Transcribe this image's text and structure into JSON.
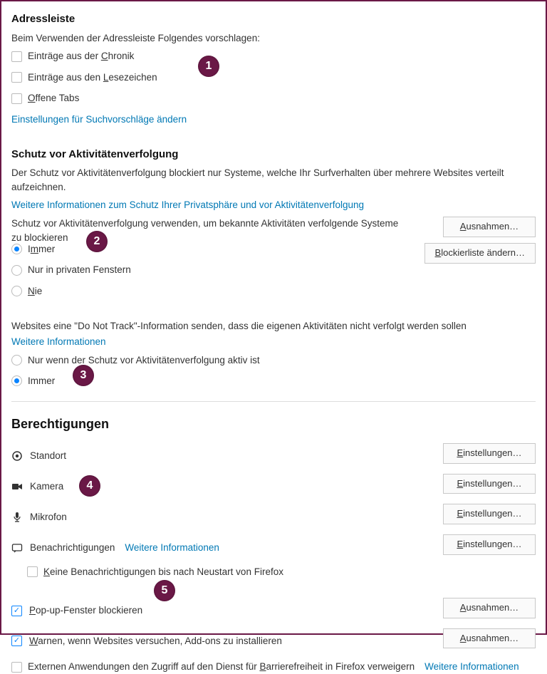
{
  "addressbar": {
    "heading": "Adressleiste",
    "sub": "Beim Verwenden der Adressleiste Folgendes vorschlagen:",
    "opt_history": "Einträge aus der Chronik",
    "opt_bookmarks": "Einträge aus den Lesezeichen",
    "opt_opentabs": "Offene Tabs",
    "link_change": "Einstellungen für Suchvorschläge ändern"
  },
  "tracking": {
    "heading": "Schutz vor Aktivitätenverfolgung",
    "desc": "Der Schutz vor Aktivitätenverfolgung blockiert nur Systeme, welche Ihr Surfverhalten über mehrere Websites verteilt aufzeichnen.",
    "more_info": "Weitere Informationen zum Schutz Ihrer Privatsphäre und vor Aktivitätenverfolgung",
    "use_desc": "Schutz vor Aktivitätenverfolgung verwenden, um bekannte Aktivitäten verfolgende Systeme zu blockieren",
    "r_always": "Immer",
    "r_private": "Nur in privaten Fenstern",
    "r_never": "Nie",
    "btn_exceptions": "Ausnahmen…",
    "btn_blocklist": "Blockierliste ändern…",
    "dnt_desc": "Websites eine \"Do Not Track\"-Information senden, dass die eigenen Aktivitäten nicht verfolgt werden sollen",
    "dnt_more": "Weitere Informationen",
    "dnt_when_active": "Nur wenn der Schutz vor Aktivitätenverfolgung aktiv ist",
    "dnt_always": "Immer"
  },
  "permissions": {
    "heading": "Berechtigungen",
    "location": "Standort",
    "camera": "Kamera",
    "microphone": "Mikrofon",
    "notifications": "Benachrichtigungen",
    "notif_more": "Weitere Informationen",
    "notif_pause": "Keine Benachrichtigungen bis nach Neustart von Firefox",
    "btn_settings": "Einstellungen…",
    "btn_exceptions": "Ausnahmen…",
    "popup": "Pop-up-Fenster blockieren",
    "warn_addons": "Warnen, wenn Websites versuchen, Add-ons zu installieren",
    "accessibility": "Externen Anwendungen den Zugriff auf den Dienst für Barrierefreiheit in Firefox verweigern",
    "acc_more": "Weitere Informationen"
  },
  "badges": {
    "b1": "1",
    "b2": "2",
    "b3": "3",
    "b4": "4",
    "b5": "5"
  }
}
